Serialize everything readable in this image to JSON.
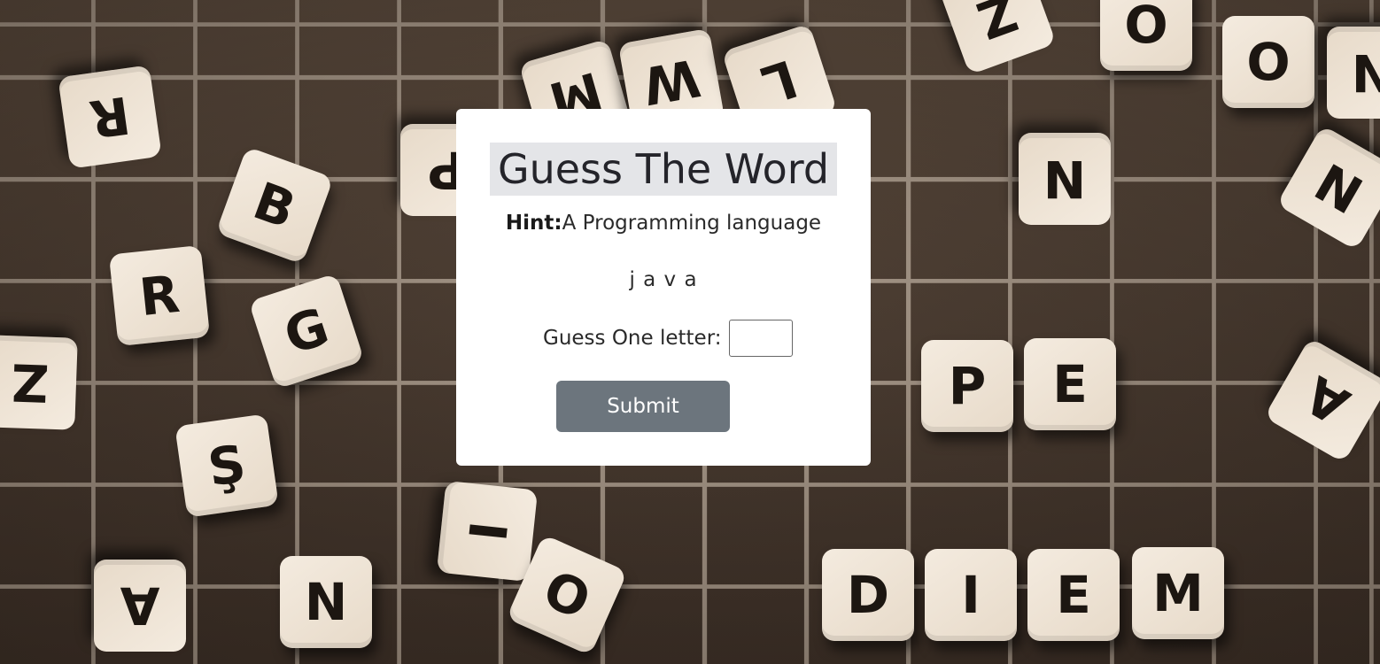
{
  "background": {
    "tiles": [
      {
        "letter": "R"
      },
      {
        "letter": "B"
      },
      {
        "letter": "R"
      },
      {
        "letter": "G"
      },
      {
        "letter": "Z"
      },
      {
        "letter": "Ş"
      },
      {
        "letter": "A"
      },
      {
        "letter": "N"
      },
      {
        "letter": "I"
      },
      {
        "letter": "O"
      },
      {
        "letter": "M"
      },
      {
        "letter": "W"
      },
      {
        "letter": "L"
      },
      {
        "letter": "Z"
      },
      {
        "letter": "O"
      },
      {
        "letter": "O"
      },
      {
        "letter": "N"
      },
      {
        "letter": "N"
      },
      {
        "letter": "P"
      },
      {
        "letter": "E"
      },
      {
        "letter": "D"
      },
      {
        "letter": "I"
      },
      {
        "letter": "E"
      },
      {
        "letter": "M"
      },
      {
        "letter": "A"
      },
      {
        "letter": "N"
      },
      {
        "letter": "P"
      }
    ]
  },
  "game": {
    "title": "Guess The Word",
    "hint_label": "Hint:",
    "hint_text": "A Programming language",
    "revealed_word": "j a v a",
    "guess_label": "Guess One letter:",
    "guess_value": "",
    "submit_label": "Submit"
  }
}
